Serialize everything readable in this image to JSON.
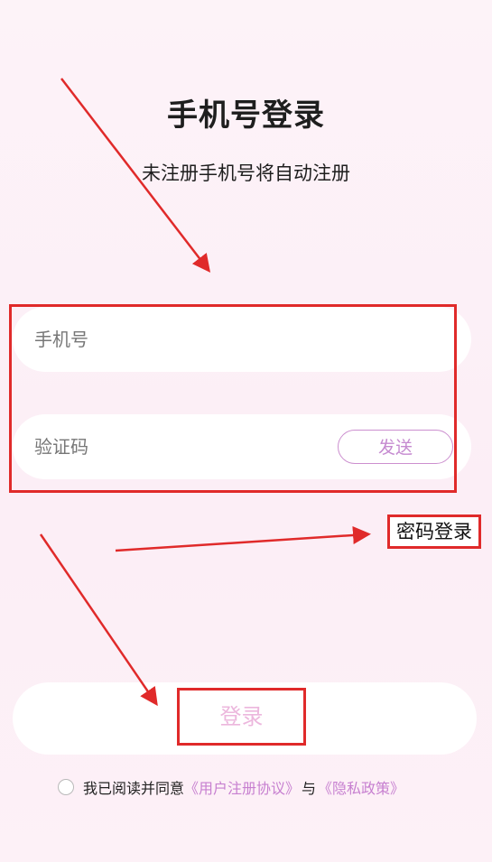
{
  "page": {
    "title": "手机号登录",
    "subtitle": "未注册手机号将自动注册"
  },
  "form": {
    "phone_placeholder": "手机号",
    "phone_value": "",
    "code_placeholder": "验证码",
    "code_value": "",
    "send_label": "发送"
  },
  "password_login_label": "密码登录",
  "login_label": "登录",
  "agreement": {
    "prefix": "我已阅读并同意",
    "user_agreement": "《用户注册协议》",
    "connector": "与",
    "privacy_policy": "《隐私政策》",
    "checked": false
  },
  "colors": {
    "accent": "#c77fd0",
    "login_text": "#ecb7dd",
    "annotation_red": "#e02a2a",
    "background": "#fdf1f7"
  }
}
